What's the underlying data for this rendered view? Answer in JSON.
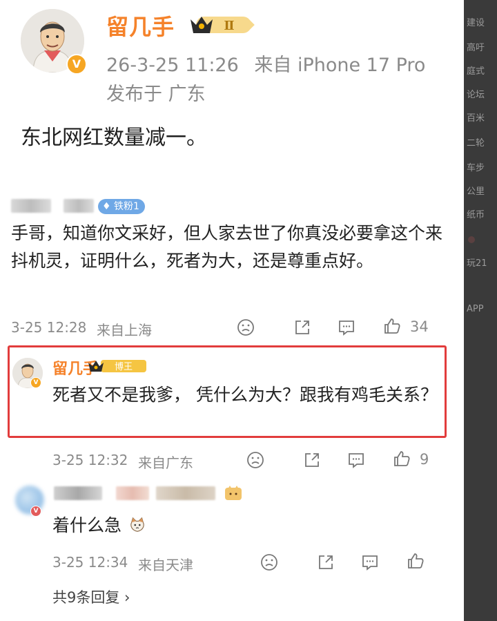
{
  "post": {
    "author": "留几手",
    "level_badge": "Ⅱ",
    "timestamp": "26-3-25 11:26",
    "source": "来自 iPhone 17 Pro",
    "location": "发布于 广东",
    "text": "东北网红数量减一。"
  },
  "comments": [
    {
      "fan_badge": "铁粉1",
      "text": "手哥，知道你文采好，但人家去世了你真没必要拿这个来抖机灵，证明什么，死者为大，还是尊重点好。",
      "time": "3-25 12:28",
      "location": "来自上海",
      "likes": "34"
    },
    {
      "author": "留几手",
      "badge": "博王",
      "text": "死者又不是我爹， 凭什么为大？跟我有鸡毛关系？",
      "time": "3-25 12:32",
      "location": "来自广东",
      "likes": "9"
    },
    {
      "text": "着什么急",
      "time": "3-25 12:34",
      "location": "来自天津"
    }
  ],
  "more_replies": "共9条回复 ›",
  "side_strip": [
    "建设",
    "高吁",
    "庭式",
    "论坛",
    "百米",
    "二轮",
    "车步",
    "公里",
    "纸币",
    "玩21",
    "APP"
  ],
  "colors": {
    "name_orange": "#f5822a",
    "highlight_red": "#e23c3c",
    "meta_gray": "#8a8a8a",
    "fan_badge_blue": "#6fa8e6"
  },
  "icons": [
    "verified-v-icon",
    "crown-icon",
    "diamond-icon",
    "sad-face-icon",
    "share-icon",
    "comment-icon",
    "thumbs-up-icon",
    "cat-emoji-icon"
  ]
}
